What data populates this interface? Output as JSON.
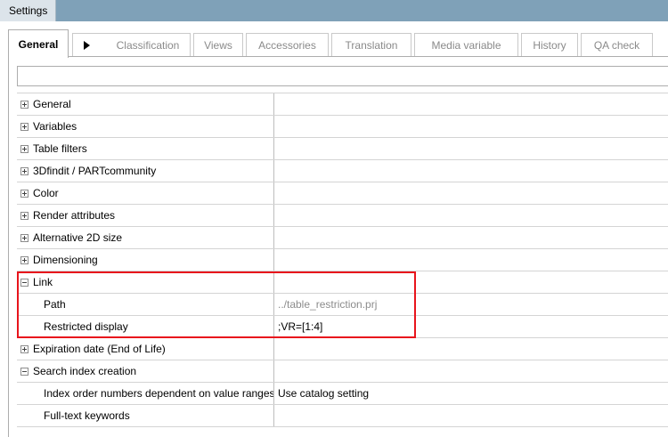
{
  "window": {
    "title": "Settings"
  },
  "tabs": [
    {
      "label": "General",
      "active": true
    },
    {
      "label": "Classification",
      "active": false
    },
    {
      "label": "Views",
      "active": false
    },
    {
      "label": "Accessories",
      "active": false
    },
    {
      "label": "Translation",
      "active": false
    },
    {
      "label": "Media variable",
      "active": false
    },
    {
      "label": "History",
      "active": false
    },
    {
      "label": "QA check",
      "active": false
    }
  ],
  "filter": {
    "value": ""
  },
  "rows": [
    {
      "name": "General",
      "expander": "plus",
      "value": ""
    },
    {
      "name": "Variables",
      "expander": "plus",
      "value": ""
    },
    {
      "name": "Table filters",
      "expander": "plus",
      "value": ""
    },
    {
      "name": "3Dfindit / PARTcommunity",
      "expander": "plus",
      "value": ""
    },
    {
      "name": "Color",
      "expander": "plus",
      "value": ""
    },
    {
      "name": "Render attributes",
      "expander": "plus",
      "value": ""
    },
    {
      "name": "Alternative 2D size",
      "expander": "plus",
      "value": ""
    },
    {
      "name": "Dimensioning",
      "expander": "plus",
      "value": ""
    },
    {
      "name": "Link",
      "expander": "minus",
      "value": ""
    },
    {
      "name": "Path",
      "expander": "none",
      "value": "../table_restriction.prj"
    },
    {
      "name": "Restricted display",
      "expander": "none",
      "value": ";VR=[1:4]"
    },
    {
      "name": "Expiration date (End of Life)",
      "expander": "plus",
      "value": ""
    },
    {
      "name": "Search index creation",
      "expander": "minus",
      "value": ""
    },
    {
      "name": "Index order numbers dependent on value ranges",
      "expander": "none",
      "value": "Use catalog setting"
    },
    {
      "name": "Full-text keywords",
      "expander": "none",
      "value": ""
    }
  ],
  "colors": {
    "title_bar": "#7fa1b8",
    "highlight": "#e8141c",
    "muted_text": "#8c8c8c"
  }
}
